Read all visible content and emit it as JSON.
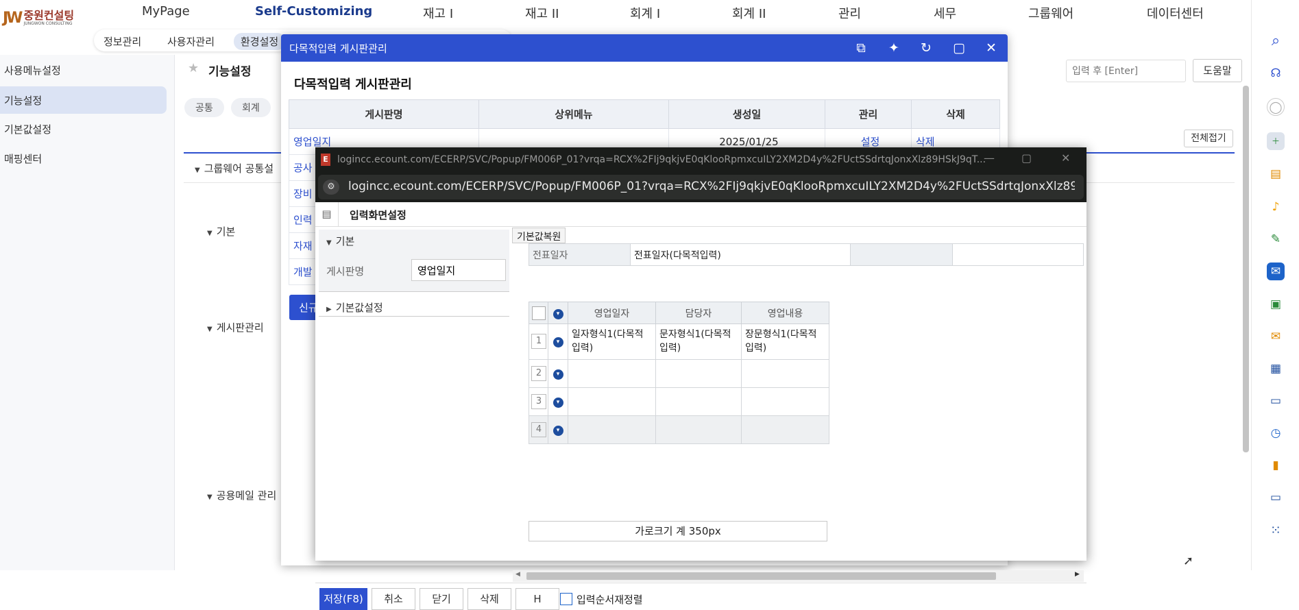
{
  "logo": {
    "korean": "중원컨설팅",
    "english": "JUNGWON CONSULTING",
    "mark": "JW"
  },
  "top_menu": [
    "MyPage",
    "Self-Customizing",
    "재고 I",
    "재고 II",
    "회계 I",
    "회계 II",
    "관리",
    "세무",
    "그룹웨어",
    "데이터센터"
  ],
  "sub_menu": [
    "정보관리",
    "사용자관리",
    "환경설정"
  ],
  "sidebar": {
    "items": [
      "사용메뉴설정",
      "기능설정",
      "기본값설정",
      "매핑센터"
    ]
  },
  "main": {
    "page_title": "기능설정",
    "chips": [
      "공통",
      "회계"
    ],
    "search_placeholder": "입력 후 [Enter]",
    "help_label": "도움말",
    "collapse_all_label": "전체접기",
    "groupware_header": "그룹웨어 공통설",
    "sections": [
      "기본",
      "게시판관리",
      "공용메일 관리"
    ]
  },
  "modal1": {
    "title": "다목적입력 게시판관리",
    "subtitle": "다목적입력 게시판관리",
    "columns": [
      "게시판명",
      "상위메뉴",
      "생성일",
      "관리",
      "삭제"
    ],
    "rows": [
      {
        "name": "영업일지",
        "parent": "",
        "date": "2025/01/25",
        "manage": "설정",
        "delete": "삭제"
      },
      {
        "name": "공사",
        "parent": "",
        "date": "",
        "manage": "",
        "delete": ""
      },
      {
        "name": "장비",
        "parent": "",
        "date": "",
        "manage": "",
        "delete": ""
      },
      {
        "name": "인력",
        "parent": "",
        "date": "",
        "manage": "",
        "delete": ""
      },
      {
        "name": "자재",
        "parent": "",
        "date": "",
        "manage": "",
        "delete": ""
      },
      {
        "name": "개발",
        "parent": "",
        "date": "",
        "manage": "",
        "delete": ""
      }
    ],
    "new_button": "신규"
  },
  "popup": {
    "window_title": "logincc.ecount.com/ECERP/SVC/Popup/FM006P_01?vrqa=RCX%2FIj9qkjvE0qKlooRpmxcuILY2XM2D4y%2FUctSSdrtqJonxXlz89HSkJ9qT...",
    "url": "logincc.ecount.com/ECERP/SVC/Popup/FM006P_01?vrqa=RCX%2FIj9qkjvE0qKlooRpmxcuILY2XM2D4y%2FUctSSdrtqJonxXlz89HSkJ9...",
    "page_title": "입력화면설정",
    "left": {
      "section_basic": "기본",
      "board_name_label": "게시판명",
      "board_name_value": "영업일지",
      "section_default": "기본값설정"
    },
    "restore_label": "기본값복원",
    "date_row": {
      "label": "전표일자",
      "value": "전표일자(다목적입력)"
    },
    "grid": {
      "columns": [
        "영업일자",
        "담당자",
        "영업내용"
      ],
      "rows": [
        {
          "num": "1",
          "cells": [
            "일자형식1(다목적입력)",
            "문자형식1(다목적입력)",
            "장문형식1(다목적입력)"
          ]
        },
        {
          "num": "2",
          "cells": [
            "",
            "",
            ""
          ]
        },
        {
          "num": "3",
          "cells": [
            "",
            "",
            ""
          ]
        },
        {
          "num": "4",
          "cells": [
            "",
            "",
            ""
          ]
        }
      ]
    },
    "width_total": "가로크기 계 350px",
    "footer": {
      "save": "저장(F8)",
      "cancel": "취소",
      "close": "닫기",
      "delete": "삭제",
      "h": "H",
      "reorder": "입력순서재정렬"
    }
  },
  "colors": {
    "accent": "#2d50cf",
    "popup_chrome": "#1a1c1a",
    "active_side": "#dbe3f4"
  }
}
